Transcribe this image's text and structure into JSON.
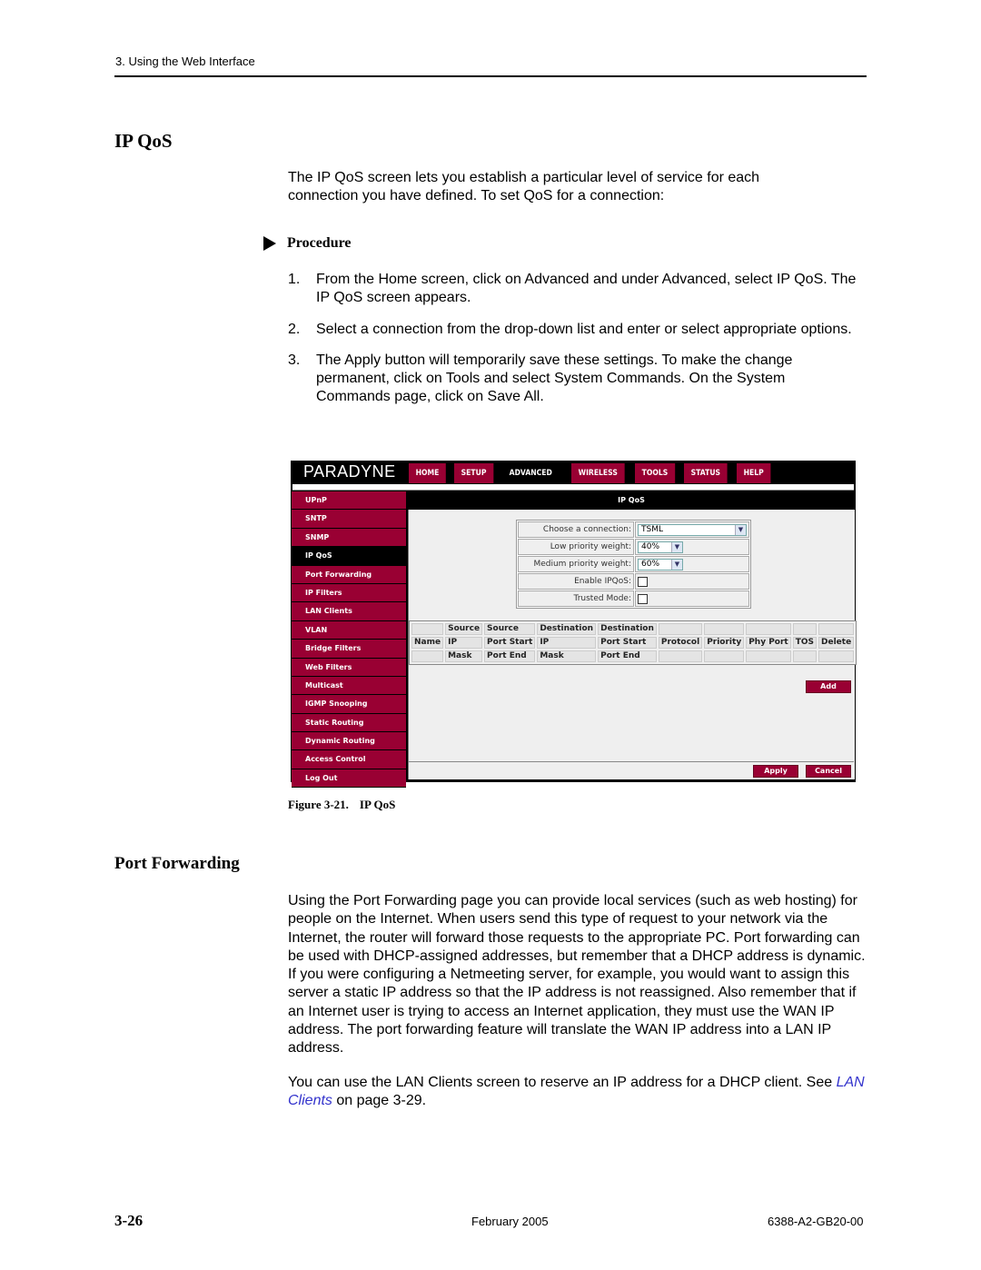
{
  "running_head": "3. Using the Web Interface",
  "section1": {
    "title": "IP QoS",
    "intro": "The IP QoS screen lets you establish a particular level of service for each connection you have defined. To set QoS for a connection:",
    "procedure_label": "Procedure",
    "steps": [
      {
        "num": "1.",
        "text": "From the Home screen, click on Advanced and under Advanced, select IP QoS. The IP QoS screen appears."
      },
      {
        "num": "2.",
        "text": "Select a connection from the drop-down list and enter or select appropriate options."
      },
      {
        "num": "3.",
        "text": "The Apply button will temporarily save these settings. To make the change permanent, click on Tools and select System Commands. On the System Commands page, click on Save All."
      }
    ]
  },
  "router_ui": {
    "logo": "PARADYNE",
    "nav": [
      {
        "label": "HOME",
        "active": false
      },
      {
        "label": "SETUP",
        "active": false
      },
      {
        "label": "ADVANCED",
        "active": true
      },
      {
        "label": "WIRELESS",
        "active": false
      },
      {
        "label": "TOOLS",
        "active": false
      },
      {
        "label": "STATUS",
        "active": false
      },
      {
        "label": "HELP",
        "active": false
      }
    ],
    "sidebar": [
      {
        "label": "UPnP",
        "active": false
      },
      {
        "label": "SNTP",
        "active": false
      },
      {
        "label": "SNMP",
        "active": false
      },
      {
        "label": "IP QoS",
        "active": true
      },
      {
        "label": "Port Forwarding",
        "active": false
      },
      {
        "label": "IP Filters",
        "active": false
      },
      {
        "label": "LAN Clients",
        "active": false
      },
      {
        "label": "VLAN",
        "active": false
      },
      {
        "label": "Bridge Filters",
        "active": false
      },
      {
        "label": "Web Filters",
        "active": false
      },
      {
        "label": "Multicast",
        "active": false
      },
      {
        "label": "IGMP Snooping",
        "active": false
      },
      {
        "label": "Static Routing",
        "active": false
      },
      {
        "label": "Dynamic Routing",
        "active": false
      },
      {
        "label": "Access Control",
        "active": false
      },
      {
        "label": "Log Out",
        "active": false
      }
    ],
    "panel_title": "IP QoS",
    "form": {
      "connection_label": "Choose a connection:",
      "connection_value": "TSML",
      "low_label": "Low priority weight:",
      "low_value": "40%",
      "medium_label": "Medium priority weight:",
      "medium_value": "60%",
      "enable_label": "Enable IPQoS:",
      "enable_checked": false,
      "trusted_label": "Trusted Mode:",
      "trusted_checked": false
    },
    "table_headers": [
      [
        "",
        "Name",
        ""
      ],
      [
        "Source",
        "IP",
        "Mask"
      ],
      [
        "Source",
        "Port Start",
        "Port End"
      ],
      [
        "Destination",
        "IP",
        "Mask"
      ],
      [
        "Destination",
        "Port Start",
        "Port End"
      ],
      [
        "",
        "Protocol",
        ""
      ],
      [
        "",
        "Priority",
        ""
      ],
      [
        "",
        "Phy Port",
        ""
      ],
      [
        "",
        "TOS",
        ""
      ],
      [
        "",
        "Delete",
        ""
      ]
    ],
    "add_label": "Add",
    "apply_label": "Apply",
    "cancel_label": "Cancel",
    "dropdown_icon": "chevron-down-icon",
    "colors": {
      "brand": "#990033",
      "nav_bg": "#000000",
      "panel_bg": "#efefef"
    }
  },
  "figure_caption": {
    "number": "Figure 3-21.",
    "title": "IP QoS"
  },
  "section2": {
    "title": "Port Forwarding",
    "para1": "Using the Port Forwarding page you can provide local services (such as web hosting) for people on the Internet. When users send this type of request to your network via the Internet, the router will forward those requests to the appropriate PC. Port forwarding can be used with DHCP-assigned addresses, but remember that a DHCP address is dynamic. If you were configuring a Netmeeting server, for example, you would want to assign this server a static IP address so that the IP address is not reassigned. Also remember that if an Internet user is trying to access an Internet application, they must use the WAN IP address. The port forwarding feature will translate the WAN IP address into a LAN IP address.",
    "para2_prefix": "You can use the LAN Clients screen to reserve an IP address for a DHCP client. See ",
    "para2_link": "LAN Clients",
    "para2_suffix": " on page 3-29."
  },
  "footer": {
    "page": "3-26",
    "date": "February 2005",
    "doc_id": "6388-A2-GB20-00"
  }
}
